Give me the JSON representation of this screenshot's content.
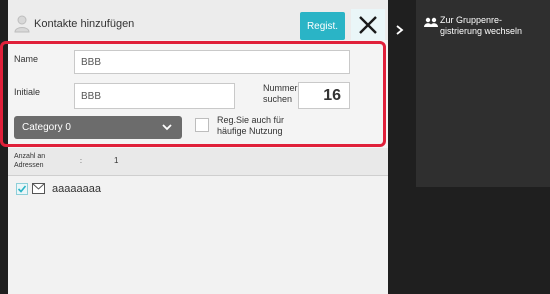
{
  "dialog": {
    "title": "Kontakte hinzufügen",
    "regist_label": "Regist.",
    "close_label": "close"
  },
  "form": {
    "name_label": "Name",
    "name_value": "BBB",
    "initials_label": "Initiale",
    "initials_value": "BBB",
    "number_search_label_line1": "Nummer",
    "number_search_label_line2": "suchen",
    "number_value": "16",
    "category_value": "Category 0",
    "frequent_use_line1": "Reg.Sie auch für",
    "frequent_use_line2": "häufige Nutzung"
  },
  "summary": {
    "count_label_line1": "Anzahl an",
    "count_label_line2": "Adressen",
    "separator": ":",
    "count_value": "1"
  },
  "entries": [
    {
      "name": "aaaaaaaa"
    }
  ],
  "side": {
    "group_switch_line1": "Zur Gruppenre-",
    "group_switch_line2": "gistrierung wechseln"
  },
  "colors": {
    "accent": "#2ab4c6",
    "highlight_border": "#e0203a",
    "category_bg": "#6c6c6c",
    "background_dark": "#1f1f1f"
  }
}
